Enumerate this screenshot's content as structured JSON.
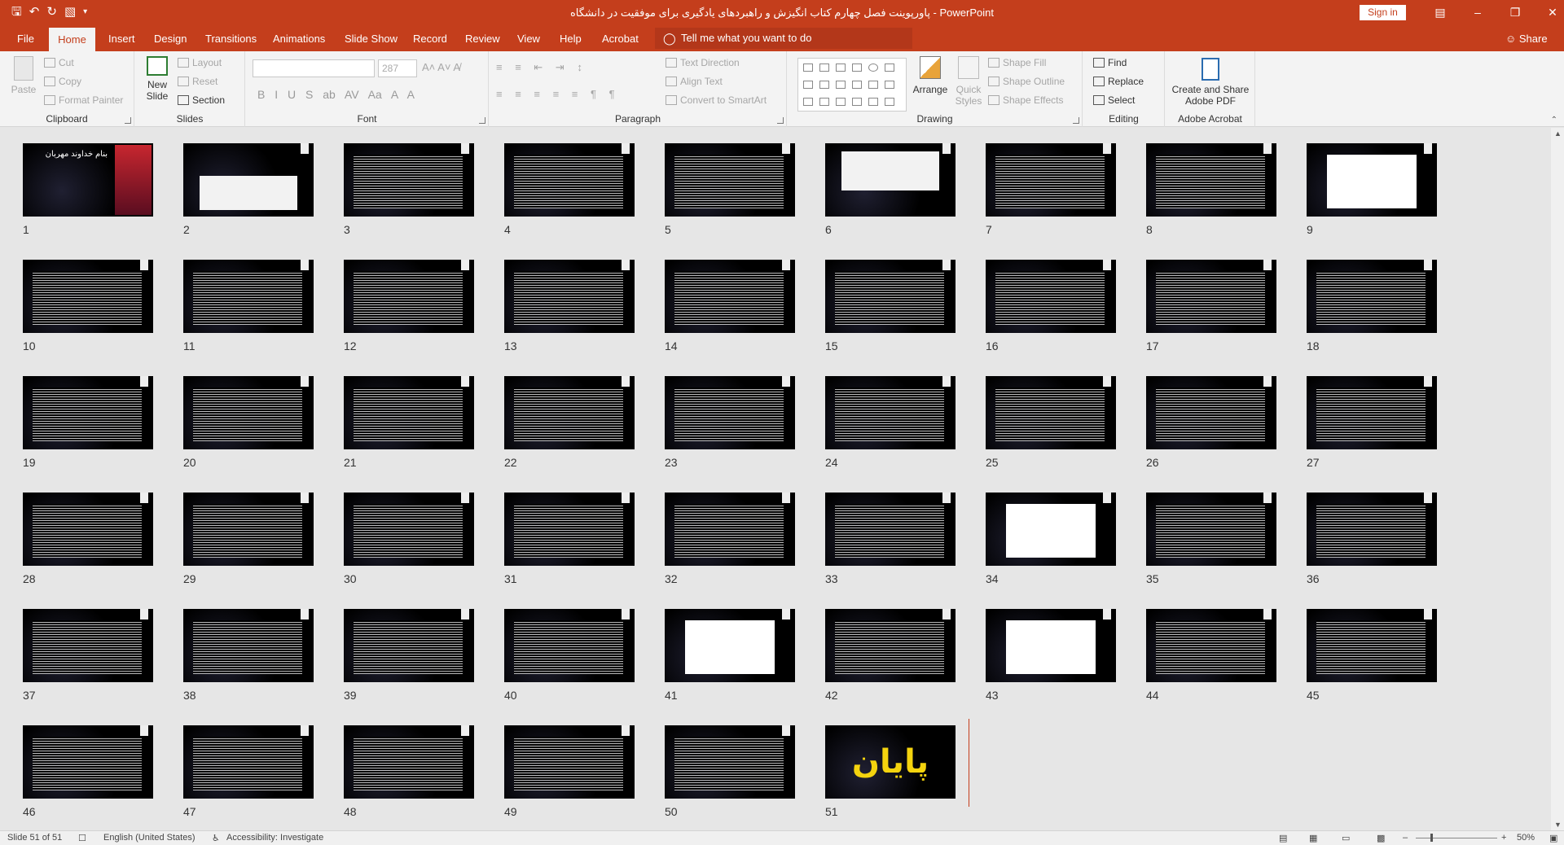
{
  "window": {
    "title": "پاورپوینت فصل چهارم کتاب انگیزش و راهبردهای یادگیری برای موفقیت در دانشگاه  -  PowerPoint",
    "sign_in": "Sign in"
  },
  "qat": {
    "save_icon": "save-icon",
    "undo_icon": "undo-icon",
    "redo_icon": "redo-icon",
    "present_icon": "present-icon"
  },
  "tabs": [
    "File",
    "Home",
    "Insert",
    "Design",
    "Transitions",
    "Animations",
    "Slide Show",
    "Record",
    "Review",
    "View",
    "Help",
    "Acrobat"
  ],
  "tell_me": "Tell me what you want to do",
  "share": "Share",
  "ribbon": {
    "clipboard": {
      "label": "Clipboard",
      "paste": "Paste",
      "cut": "Cut",
      "copy": "Copy",
      "format_painter": "Format Painter"
    },
    "slides": {
      "label": "Slides",
      "new_slide_1": "New",
      "new_slide_2": "Slide",
      "layout": "Layout",
      "reset": "Reset",
      "section": "Section"
    },
    "font": {
      "label": "Font",
      "font_size": "287"
    },
    "paragraph": {
      "label": "Paragraph",
      "text_direction": "Text Direction",
      "align_text": "Align Text",
      "convert_smartart": "Convert to SmartArt"
    },
    "drawing": {
      "label": "Drawing",
      "arrange": "Arrange",
      "quick_styles_1": "Quick",
      "quick_styles_2": "Styles",
      "shape_fill": "Shape Fill",
      "shape_outline": "Shape Outline",
      "shape_effects": "Shape Effects"
    },
    "editing": {
      "label": "Editing",
      "find": "Find",
      "replace": "Replace",
      "select": "Select"
    },
    "acrobat": {
      "label": "Adobe Acrobat",
      "create_share_1": "Create and Share",
      "create_share_2": "Adobe PDF"
    }
  },
  "slides": [
    {
      "n": "1",
      "k": "cover",
      "title": "بنام خداوند مهربان"
    },
    {
      "n": "2",
      "k": "diagram"
    },
    {
      "n": "3",
      "k": "text"
    },
    {
      "n": "4",
      "k": "text"
    },
    {
      "n": "5",
      "k": "text"
    },
    {
      "n": "6",
      "k": "img2"
    },
    {
      "n": "7",
      "k": "text"
    },
    {
      "n": "8",
      "k": "text"
    },
    {
      "n": "9",
      "k": "img"
    },
    {
      "n": "10",
      "k": "text"
    },
    {
      "n": "11",
      "k": "text"
    },
    {
      "n": "12",
      "k": "text"
    },
    {
      "n": "13",
      "k": "text"
    },
    {
      "n": "14",
      "k": "text"
    },
    {
      "n": "15",
      "k": "text"
    },
    {
      "n": "16",
      "k": "text"
    },
    {
      "n": "17",
      "k": "text"
    },
    {
      "n": "18",
      "k": "text"
    },
    {
      "n": "19",
      "k": "text"
    },
    {
      "n": "20",
      "k": "text"
    },
    {
      "n": "21",
      "k": "text"
    },
    {
      "n": "22",
      "k": "text"
    },
    {
      "n": "23",
      "k": "text"
    },
    {
      "n": "24",
      "k": "text"
    },
    {
      "n": "25",
      "k": "text"
    },
    {
      "n": "26",
      "k": "text"
    },
    {
      "n": "27",
      "k": "text"
    },
    {
      "n": "28",
      "k": "text"
    },
    {
      "n": "29",
      "k": "text"
    },
    {
      "n": "30",
      "k": "text"
    },
    {
      "n": "31",
      "k": "text"
    },
    {
      "n": "32",
      "k": "text"
    },
    {
      "n": "33",
      "k": "text"
    },
    {
      "n": "34",
      "k": "img"
    },
    {
      "n": "35",
      "k": "text"
    },
    {
      "n": "36",
      "k": "text"
    },
    {
      "n": "37",
      "k": "text"
    },
    {
      "n": "38",
      "k": "text"
    },
    {
      "n": "39",
      "k": "text"
    },
    {
      "n": "40",
      "k": "text"
    },
    {
      "n": "41",
      "k": "img"
    },
    {
      "n": "42",
      "k": "text"
    },
    {
      "n": "43",
      "k": "img"
    },
    {
      "n": "44",
      "k": "text"
    },
    {
      "n": "45",
      "k": "text"
    },
    {
      "n": "46",
      "k": "text"
    },
    {
      "n": "47",
      "k": "text"
    },
    {
      "n": "48",
      "k": "text"
    },
    {
      "n": "49",
      "k": "text"
    },
    {
      "n": "50",
      "k": "text"
    },
    {
      "n": "51",
      "k": "end",
      "title": "پایان"
    }
  ],
  "status": {
    "slide": "Slide 51 of 51",
    "language": "English (United States)",
    "accessibility": "Accessibility: Investigate",
    "zoom": "50%"
  }
}
